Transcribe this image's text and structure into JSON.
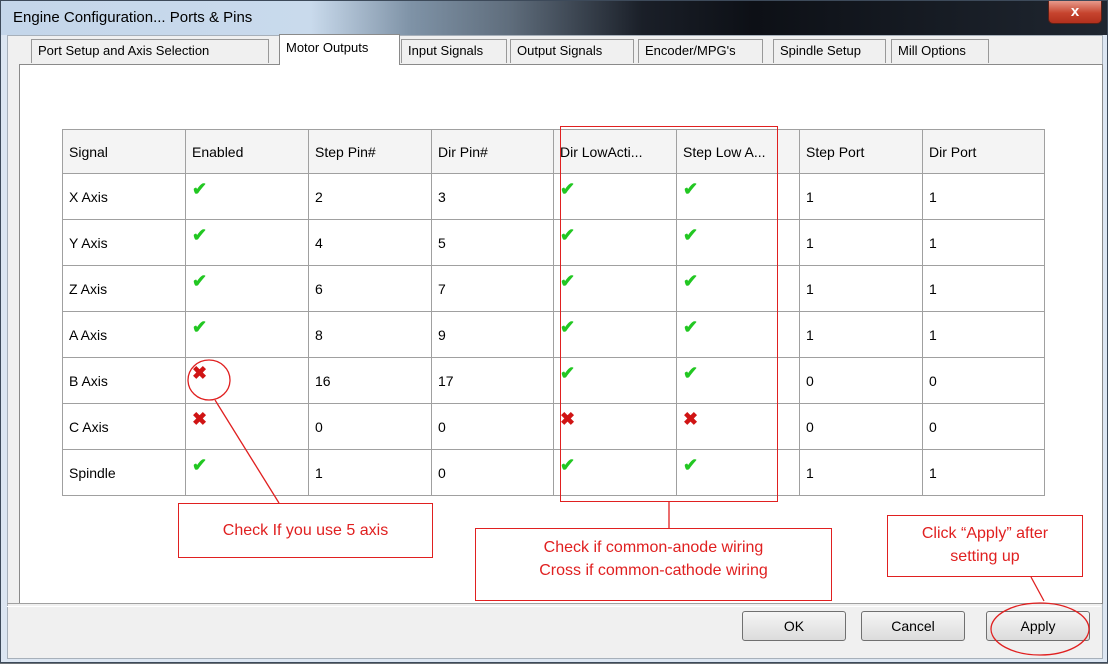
{
  "window": {
    "title": "Engine Configuration... Ports & Pins",
    "close_label": "x"
  },
  "tabs": [
    {
      "label": "Port Setup and Axis Selection",
      "selected": false
    },
    {
      "label": "Motor Outputs",
      "selected": true
    },
    {
      "label": "Input Signals",
      "selected": false
    },
    {
      "label": "Output Signals",
      "selected": false
    },
    {
      "label": "Encoder/MPG's",
      "selected": false
    },
    {
      "label": "Spindle Setup",
      "selected": false
    },
    {
      "label": "Mill Options",
      "selected": false
    }
  ],
  "table": {
    "columns": [
      "Signal",
      "Enabled",
      "Step Pin#",
      "Dir Pin#",
      "Dir LowActi...",
      "Step Low A...",
      "Step Port",
      "Dir Port"
    ],
    "rows": [
      {
        "signal": "X Axis",
        "enabled": "check",
        "step_pin": "2",
        "dir_pin": "3",
        "dir_low": "check",
        "step_low": "check",
        "step_port": "1",
        "dir_port": "1"
      },
      {
        "signal": "Y Axis",
        "enabled": "check",
        "step_pin": "4",
        "dir_pin": "5",
        "dir_low": "check",
        "step_low": "check",
        "step_port": "1",
        "dir_port": "1"
      },
      {
        "signal": "Z Axis",
        "enabled": "check",
        "step_pin": "6",
        "dir_pin": "7",
        "dir_low": "check",
        "step_low": "check",
        "step_port": "1",
        "dir_port": "1"
      },
      {
        "signal": "A Axis",
        "enabled": "check",
        "step_pin": "8",
        "dir_pin": "9",
        "dir_low": "check",
        "step_low": "check",
        "step_port": "1",
        "dir_port": "1"
      },
      {
        "signal": "B Axis",
        "enabled": "cross",
        "step_pin": "16",
        "dir_pin": "17",
        "dir_low": "check",
        "step_low": "check",
        "step_port": "0",
        "dir_port": "0"
      },
      {
        "signal": "C Axis",
        "enabled": "cross",
        "step_pin": "0",
        "dir_pin": "0",
        "dir_low": "cross",
        "step_low": "cross",
        "step_port": "0",
        "dir_port": "0"
      },
      {
        "signal": "Spindle",
        "enabled": "check",
        "step_pin": "1",
        "dir_pin": "0",
        "dir_low": "check",
        "step_low": "check",
        "step_port": "1",
        "dir_port": "1"
      }
    ]
  },
  "icons": {
    "check": "green-check-icon",
    "cross": "red-cross-icon"
  },
  "annotations": {
    "five_axis": "Check If you use 5 axis",
    "wiring_line1": "Check if common-anode wiring",
    "wiring_line2": "Cross if common-cathode wiring",
    "apply_line1": "Click “Apply” after",
    "apply_line2": "setting up"
  },
  "buttons": {
    "ok": "OK",
    "cancel": "Cancel",
    "apply": "Apply"
  },
  "colors": {
    "check": "#22c722",
    "cross": "#d01414",
    "annotation": "#e02020"
  }
}
